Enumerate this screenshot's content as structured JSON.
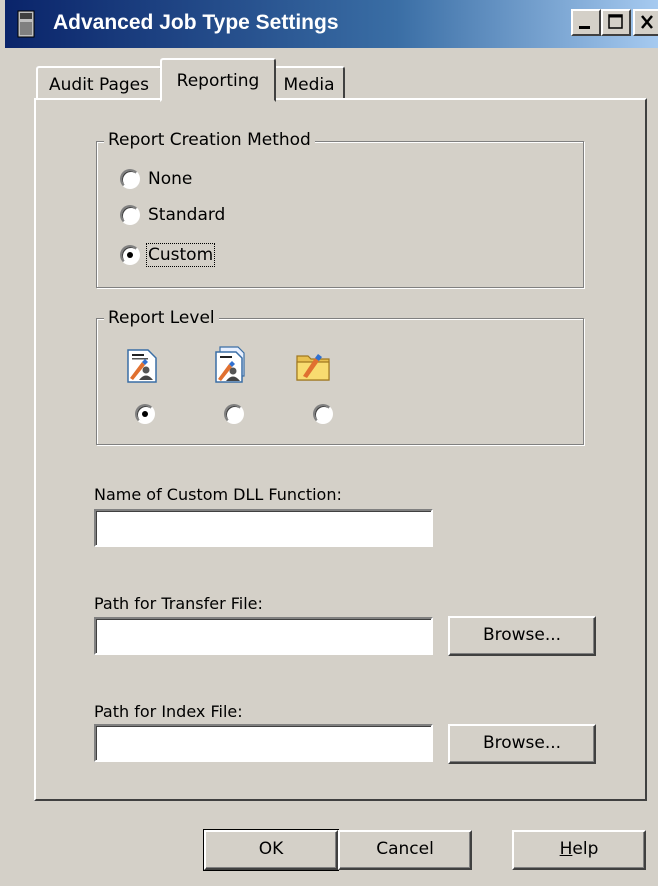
{
  "window": {
    "title": "Advanced Job Type Settings"
  },
  "titlebar_buttons": [
    "minimize",
    "maximize",
    "close"
  ],
  "tabs": [
    {
      "label": "Audit Pages",
      "selected": false
    },
    {
      "label": "Reporting",
      "selected": true
    },
    {
      "label": "Media",
      "selected": false
    }
  ],
  "report_creation": {
    "title": "Report Creation Method",
    "options": [
      {
        "label": "None",
        "checked": false
      },
      {
        "label": "Standard",
        "checked": false
      },
      {
        "label": "Custom",
        "checked": true
      }
    ]
  },
  "report_level": {
    "title": "Report Level",
    "options": [
      {
        "icon": "report-document-users-icon",
        "checked": true
      },
      {
        "icon": "report-documents-users-icon",
        "checked": false
      },
      {
        "icon": "report-folder-pencil-icon",
        "checked": false
      }
    ]
  },
  "fields": {
    "dll_function": {
      "label": "Name of Custom DLL Function:",
      "value": ""
    },
    "transfer_file": {
      "label": "Path for Transfer File:",
      "value": "",
      "browse_label": "Browse..."
    },
    "index_file": {
      "label": "Path for Index File:",
      "value": "",
      "browse_label": "Browse..."
    }
  },
  "buttons": {
    "ok": "OK",
    "cancel": "Cancel",
    "help_mnemonic": "H",
    "help_rest": "elp"
  },
  "colors": {
    "face": "#d4d0c8",
    "title_start": "#0a246a",
    "title_end": "#a6caf0"
  }
}
